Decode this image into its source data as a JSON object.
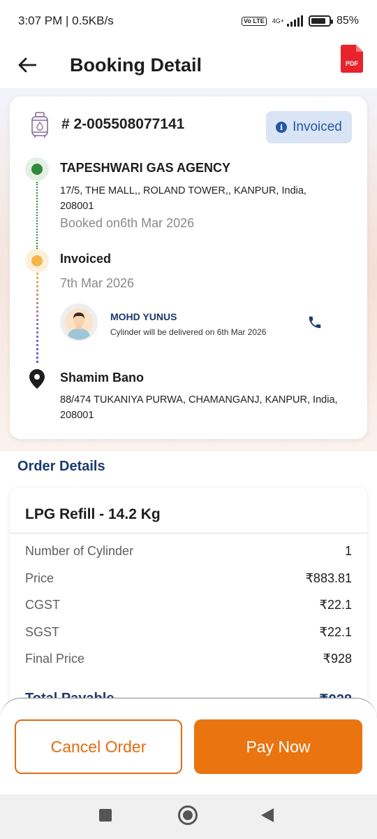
{
  "status_bar": {
    "time": "3:07 PM | 0.5KB/s",
    "network": "4G+",
    "volte": "Vo LTE",
    "battery": "85%",
    "battery_level": 0.85
  },
  "header": {
    "title": "Booking Detail",
    "pdf_label": "PDF"
  },
  "booking": {
    "id": "# 2-005508077141",
    "status": "Invoiced",
    "agency": {
      "name": "TAPESHWARI GAS AGENCY",
      "address": "17/5, THE MALL,, ROLAND TOWER,, KANPUR, India, 208001",
      "booked_on": "Booked on6th Mar 2026"
    },
    "invoice": {
      "label": "Invoiced",
      "date": "7th Mar 2026"
    },
    "delivery": {
      "driver_name": "MOHD YUNUS",
      "note": "Cylinder will be delivered on 6th Mar 2026"
    },
    "customer": {
      "name": "Shamim Bano",
      "address": "88/474 TUKANIYA PURWA, CHAMANGANJ, KANPUR, India, 208001"
    }
  },
  "order_details": {
    "section_title": "Order Details",
    "product": "LPG Refill - 14.2 Kg",
    "rows": [
      {
        "label": "Number of Cylinder",
        "value": "1"
      },
      {
        "label": "Price",
        "value": "₹883.81"
      },
      {
        "label": "CGST",
        "value": "₹22.1"
      },
      {
        "label": "SGST",
        "value": "₹22.1"
      },
      {
        "label": "Final Price",
        "value": "₹928"
      }
    ],
    "total": {
      "label": "Total Payable",
      "value": "₹928"
    }
  },
  "actions": {
    "cancel": "Cancel Order",
    "pay": "Pay Now"
  },
  "colors": {
    "accent": "#e97410",
    "navy": "#1c3a6e",
    "status_chip_bg": "#d9e4f4",
    "status_chip_text": "#2456a6",
    "green": "#2f8a3b",
    "amber": "#f5b548"
  }
}
